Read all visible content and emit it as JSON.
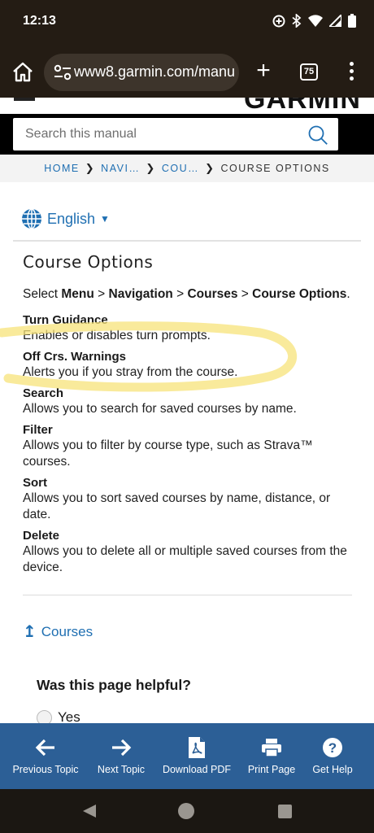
{
  "status_bar": {
    "time": "12:13",
    "icons": [
      "data-saver-icon",
      "bluetooth-icon",
      "wifi-icon",
      "signal-icon",
      "battery-icon"
    ]
  },
  "browser": {
    "url": "www8.garmin.com/manu",
    "tab_count": "75",
    "icons": [
      "home-icon",
      "site-settings-icon",
      "plus-icon",
      "tab-switcher-icon",
      "overflow-menu-icon"
    ]
  },
  "header": {
    "logo_text": "GARMIN",
    "search_placeholder": "Search this manual"
  },
  "breadcrumb": {
    "items": [
      "HOME",
      "NAVI…",
      "COU…"
    ],
    "current": "COURSE OPTIONS"
  },
  "language": {
    "label": "English"
  },
  "page": {
    "title": "Course Options",
    "intro": {
      "select": "Select ",
      "menu": "Menu",
      "navigation": "Navigation",
      "courses": "Courses",
      "course_options": "Course Options",
      "sep": " > ",
      "end": "."
    },
    "options": [
      {
        "title": "Turn Guidance",
        "desc": "Enables or disables turn prompts."
      },
      {
        "title": "Off Crs. Warnings",
        "desc": "Alerts you if you stray from the course."
      },
      {
        "title": "Search",
        "desc": "Allows you to search for saved courses by name."
      },
      {
        "title": "Filter",
        "desc": "Allows you to filter by course type, such as Strava™ courses."
      },
      {
        "title": "Sort",
        "desc": "Allows you to sort saved courses by name, distance, or date."
      },
      {
        "title": "Delete",
        "desc": "Allows you to delete all or multiple saved courses from the device."
      }
    ],
    "up_link": "Courses",
    "helpful_question": "Was this page helpful?",
    "yes_label": "Yes"
  },
  "bottom_nav": {
    "previous": "Previous Topic",
    "next": "Next Topic",
    "download": "Download PDF",
    "print": "Print Page",
    "help": "Get Help"
  },
  "colors": {
    "link_blue": "#1f6fb2",
    "toolbar_blue": "#2c5f96",
    "highlight_yellow": "#f7e37a",
    "browser_dark": "#241c14"
  }
}
